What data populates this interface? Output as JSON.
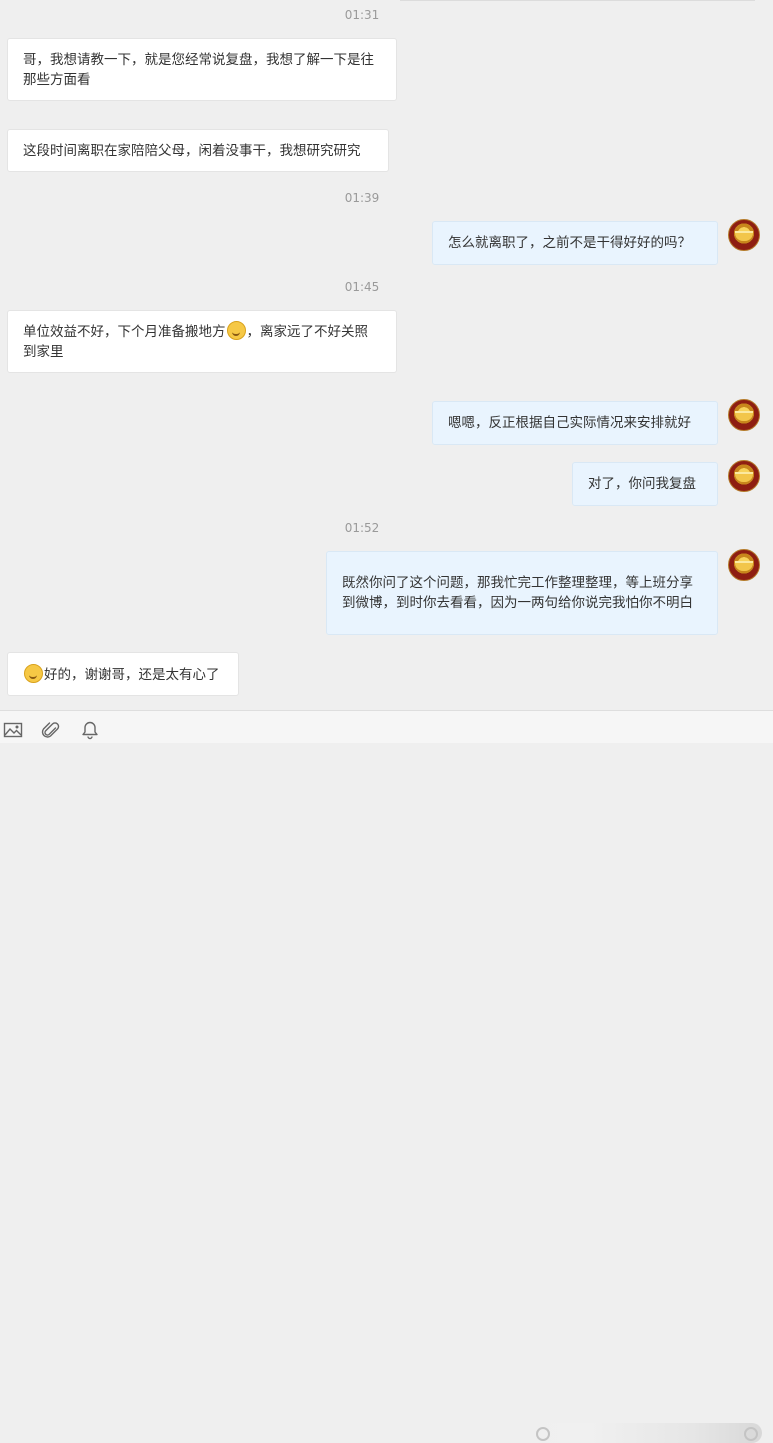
{
  "messages": [
    {
      "kind": "time",
      "text": "01:31"
    },
    {
      "kind": "in",
      "text": "哥，我想请教一下，就是您经常说复盘，我想了解一下是往那些方面看"
    },
    {
      "kind": "in",
      "text": "这段时间离职在家陪陪父母，闲着没事干，我想研究研究"
    },
    {
      "kind": "time",
      "text": "01:39"
    },
    {
      "kind": "out",
      "text": "怎么就离职了，之前不是干得好好的吗？"
    },
    {
      "kind": "time",
      "text": "01:45"
    },
    {
      "kind": "in",
      "text_before": "单位效益不好，下个月准备搬地方",
      "emoji": "sweat-smile-emoji",
      "text_after": "，离家远了不好关照到家里"
    },
    {
      "kind": "out",
      "text": "嗯嗯，反正根据自己实际情况来安排就好"
    },
    {
      "kind": "out",
      "text": "对了，你问我复盘"
    },
    {
      "kind": "time",
      "text": "01:52"
    },
    {
      "kind": "out",
      "text": "既然你问了这个问题，那我忙完工作整理整理，等上班分享到微博，到时你去看看，因为一两句给你说完我怕你不明白"
    },
    {
      "kind": "in",
      "emoji": "grin-emoji",
      "text_after": "好的，谢谢哥，还是太有心了"
    }
  ],
  "toolbar": {
    "icons": [
      "image-icon",
      "attachment-icon",
      "bell-icon"
    ]
  },
  "colors": {
    "background": "#efefef",
    "incoming_bubble": "#ffffff",
    "outgoing_bubble": "#e9f4fe",
    "timestamp": "#9a9a9a"
  }
}
